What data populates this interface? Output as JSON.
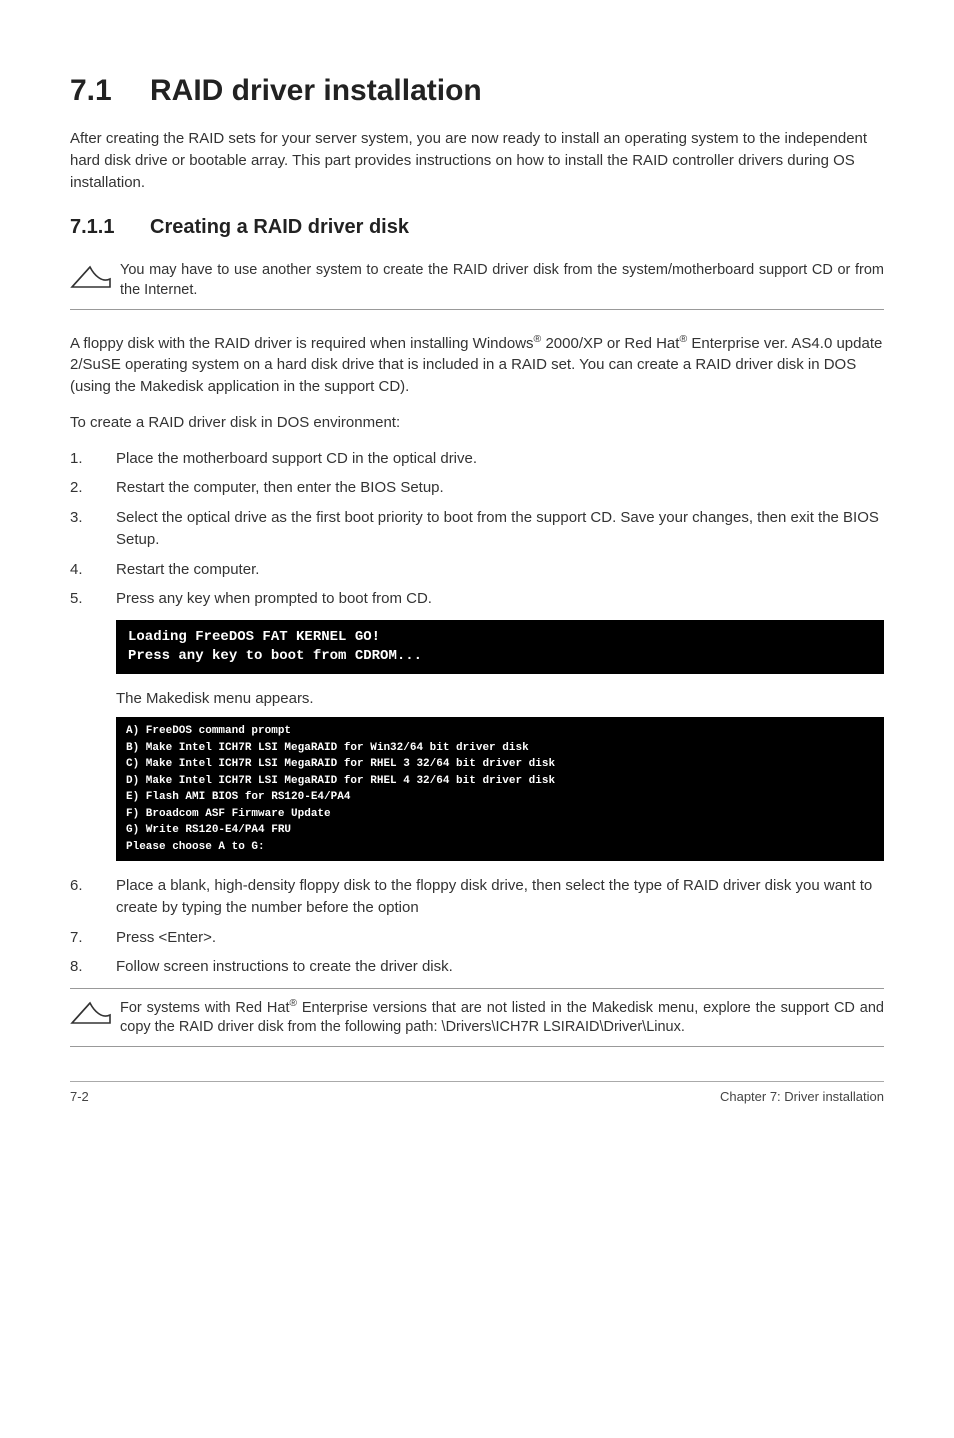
{
  "heading": {
    "number": "7.1",
    "title": "RAID driver installation"
  },
  "intro": "After creating the RAID sets for your server system, you are now ready to install an operating system to the independent hard disk drive or bootable array. This part provides instructions on how to install the RAID controller drivers during OS installation.",
  "subheading": {
    "number": "7.1.1",
    "title": "Creating a RAID driver disk"
  },
  "note1": "You may have to use another system to create the RAID driver disk from the system/motherboard support CD or from the Internet.",
  "body1_pre": "A floppy disk with the RAID driver is required when installing Windows",
  "body1_mid": " 2000/XP or Red Hat",
  "body1_post": " Enterprise ver. AS4.0 update 2/SuSE operating system on a hard disk drive that is included in a RAID set. You can create a RAID driver disk in DOS (using the Makedisk application in the support CD).",
  "body2": "To create a RAID driver disk in DOS environment:",
  "steps1": [
    "Place the motherboard support CD in the optical drive.",
    "Restart the computer, then enter the BIOS Setup.",
    "Select the optical drive as the first boot priority to boot from the support CD. Save your changes, then exit the BIOS Setup.",
    "Restart the computer.",
    "Press any key when prompted to boot from CD."
  ],
  "code1": "Loading FreeDOS FAT KERNEL GO!\nPress any key to boot from CDROM...",
  "makedisk_caption": "The Makedisk menu appears.",
  "code2": "A) FreeDOS command prompt\nB) Make Intel ICH7R LSI MegaRAID for Win32/64 bit driver disk\nC) Make Intel ICH7R LSI MegaRAID for RHEL 3 32/64 bit driver disk\nD) Make Intel ICH7R LSI MegaRAID for RHEL 4 32/64 bit driver disk\nE) Flash AMI BIOS for RS120-E4/PA4\nF) Broadcom ASF Firmware Update\nG) Write RS120-E4/PA4 FRU\nPlease choose A to G:",
  "steps2": [
    "Place a blank, high-density floppy disk to the floppy disk drive, then select the type of RAID driver disk you want to create by typing the number before the option",
    "Press <Enter>.",
    "Follow screen instructions to create the driver disk."
  ],
  "note2_pre": "For systems with Red Hat",
  "note2_post": " Enterprise versions that are not listed in the Makedisk menu, explore the support CD and copy the RAID driver disk from the following path: \\Drivers\\ICH7R LSIRAID\\Driver\\Linux.",
  "footer": {
    "left": "7-2",
    "right": "Chapter 7: Driver installation"
  }
}
